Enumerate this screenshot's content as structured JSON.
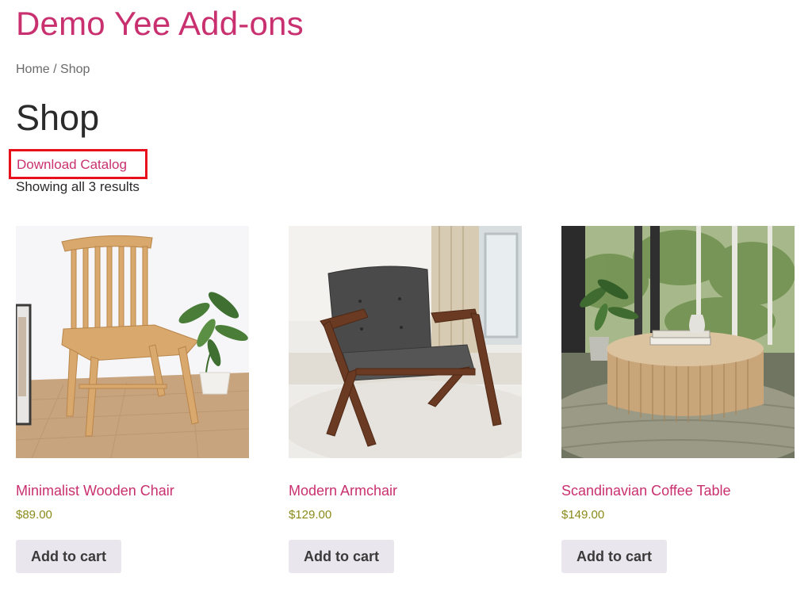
{
  "site": {
    "title": "Demo Yee Add-ons"
  },
  "breadcrumb": {
    "home": "Home",
    "separator": " / ",
    "current": "Shop"
  },
  "page": {
    "title": "Shop"
  },
  "catalog": {
    "label": "Download Catalog"
  },
  "results": {
    "text": "Showing all 3 results"
  },
  "products": [
    {
      "name": "Minimalist Wooden Chair",
      "price": "$89.00",
      "button": "Add to cart"
    },
    {
      "name": "Modern Armchair",
      "price": "$129.00",
      "button": "Add to cart"
    },
    {
      "name": "Scandinavian Coffee Table",
      "price": "$149.00",
      "button": "Add to cart"
    }
  ],
  "colors": {
    "accent": "#c9306f",
    "price": "#8a8a1a",
    "highlight_border": "#e8101b",
    "button_bg": "#e9e6ed"
  }
}
